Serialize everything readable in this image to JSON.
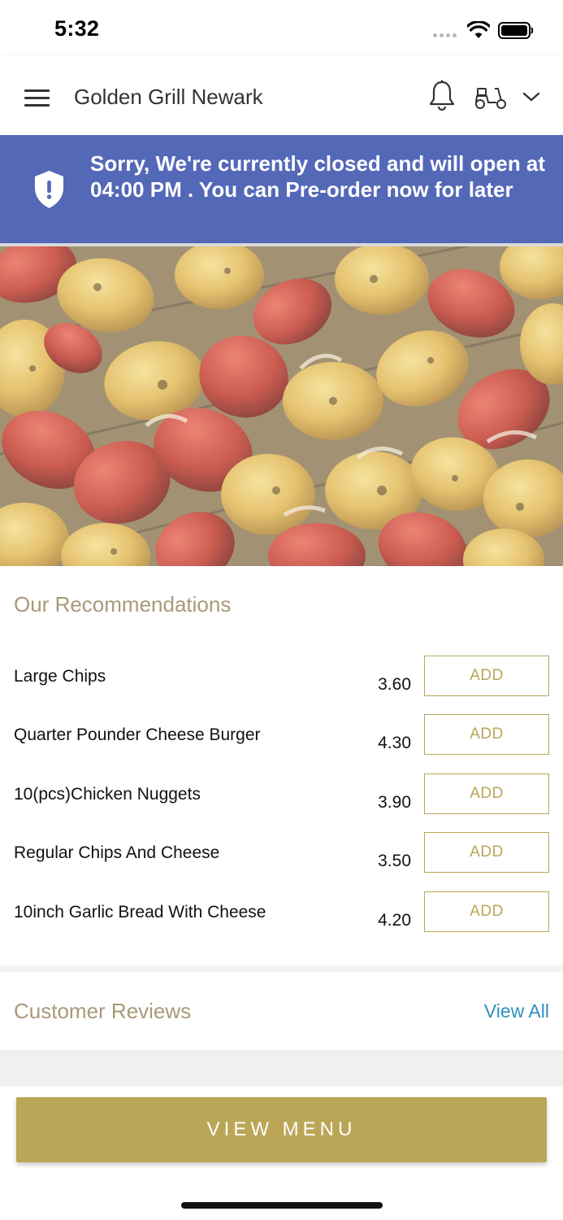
{
  "status_bar": {
    "time": "5:32"
  },
  "header": {
    "title": "Golden Grill Newark"
  },
  "banner": {
    "message": "Sorry, We're currently closed and will open at 04:00 PM . You can Pre-order now for later",
    "color": "#5468b8"
  },
  "hero": {
    "icon": "chicken-kebab-photo"
  },
  "recommendations": {
    "title": "Our Recommendations",
    "items": [
      {
        "name": "Large Chips",
        "price": "3.60",
        "action": "ADD"
      },
      {
        "name": "Quarter Pounder Cheese Burger",
        "price": "4.30",
        "action": "ADD"
      },
      {
        "name": "10(pcs)Chicken Nuggets",
        "price": "3.90",
        "action": "ADD"
      },
      {
        "name": "Regular Chips And Cheese",
        "price": "3.50",
        "action": "ADD"
      },
      {
        "name": "10inch Garlic Bread With Cheese",
        "price": "4.20",
        "action": "ADD"
      }
    ]
  },
  "reviews": {
    "title": "Customer Reviews",
    "view_all": "View All"
  },
  "footer": {
    "view_menu": "VIEW MENU"
  },
  "colors": {
    "accent": "#baa656",
    "section_title": "#a89a78",
    "link": "#2e8fbc"
  },
  "icons": [
    "menu-icon",
    "bell-icon",
    "scooter-icon",
    "chevron-down-icon",
    "shield-icon",
    "wifi-icon",
    "battery-icon"
  ]
}
